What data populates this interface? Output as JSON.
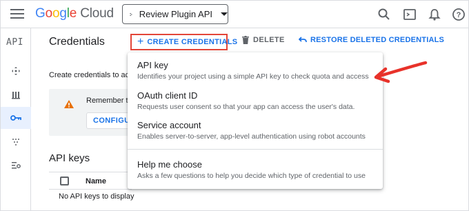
{
  "header": {
    "logo_google": "Google",
    "logo_cloud": "Cloud",
    "project_name": "Review Plugin API",
    "icons": [
      "menu-icon",
      "search-icon",
      "terminal-icon",
      "bell-icon",
      "help-icon"
    ]
  },
  "rail": {
    "label": "API",
    "items": [
      "dashboard-icon",
      "library-icon",
      "key-icon",
      "oauth-icon",
      "settings-list-icon"
    ],
    "active_index": 2
  },
  "toolbar": {
    "title": "Credentials",
    "create_label": "CREATE CREDENTIALS",
    "delete_label": "DELETE",
    "restore_label": "RESTORE DELETED CREDENTIALS"
  },
  "body": {
    "intro": "Create credentials to acc",
    "warning_text": "Remember t",
    "configure_label": "CONFIGUR",
    "api_keys_title": "API keys",
    "column_name": "Name",
    "empty_text": "No API keys to display"
  },
  "menu": {
    "items": [
      {
        "title": "API key",
        "desc": "Identifies your project using a simple API key to check quota and access"
      },
      {
        "title": "OAuth client ID",
        "desc": "Requests user consent so that your app can access the user's data."
      },
      {
        "title": "Service account",
        "desc": "Enables server-to-server, app-level authentication using robot accounts"
      },
      {
        "title": "Help me choose",
        "desc": "Asks a few questions to help you decide which type of credential to use"
      }
    ]
  },
  "colors": {
    "accent": "#1a73e8",
    "highlight_border": "#e34538",
    "annotation_arrow": "#e8322a",
    "warning": "#e8710a"
  }
}
